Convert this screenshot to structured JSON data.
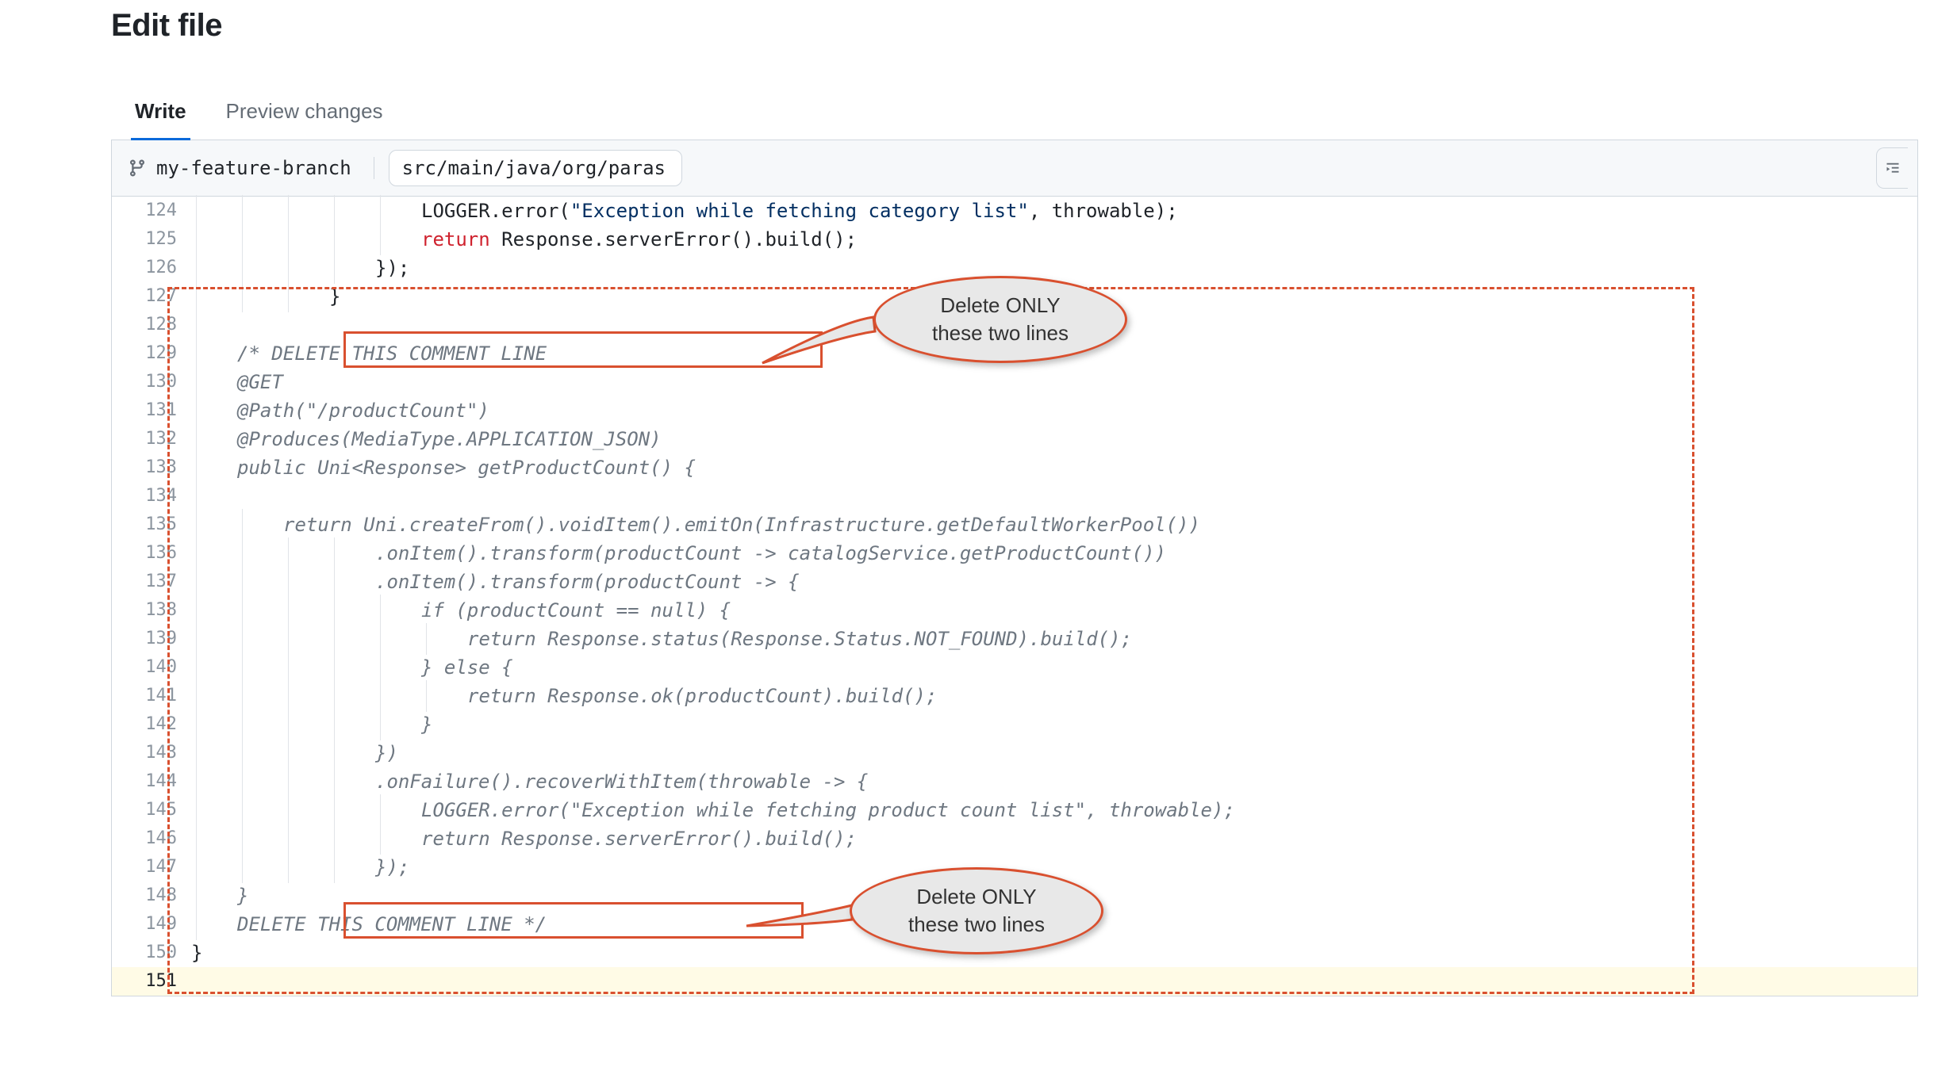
{
  "header": {
    "title": "Edit file"
  },
  "tabs": {
    "write": "Write",
    "preview": "Preview changes"
  },
  "branch": {
    "name": "my-feature-branch",
    "path": "src/main/java/org/paras"
  },
  "lines": [
    {
      "n": 124,
      "indent": 5,
      "segments": [
        {
          "t": "plain",
          "v": "LOGGER.error("
        },
        {
          "t": "strlit",
          "v": "\"Exception while fetching category list\""
        },
        {
          "t": "plain",
          "v": ", throwable);"
        }
      ]
    },
    {
      "n": 125,
      "indent": 5,
      "segments": [
        {
          "t": "kw",
          "v": "return"
        },
        {
          "t": "plain",
          "v": " Response.serverError().build();"
        }
      ]
    },
    {
      "n": 126,
      "indent": 4,
      "segments": [
        {
          "t": "plain",
          "v": "});"
        }
      ]
    },
    {
      "n": 127,
      "indent": 3,
      "segments": [
        {
          "t": "plain",
          "v": "}"
        }
      ]
    },
    {
      "n": 128,
      "indent": 1,
      "segments": []
    },
    {
      "n": 129,
      "indent": 1,
      "segments": [
        {
          "t": "comment",
          "v": "/* DELETE THIS COMMENT LINE"
        }
      ]
    },
    {
      "n": 130,
      "indent": 1,
      "segments": [
        {
          "t": "comment",
          "v": "@GET"
        }
      ]
    },
    {
      "n": 131,
      "indent": 1,
      "segments": [
        {
          "t": "comment",
          "v": "@Path(\"/productCount\")"
        }
      ]
    },
    {
      "n": 132,
      "indent": 1,
      "segments": [
        {
          "t": "comment",
          "v": "@Produces(MediaType.APPLICATION_JSON)"
        }
      ]
    },
    {
      "n": 133,
      "indent": 1,
      "segments": [
        {
          "t": "comment",
          "v": "public Uni<Response> getProductCount() {"
        }
      ]
    },
    {
      "n": 134,
      "indent": 1,
      "segments": []
    },
    {
      "n": 135,
      "indent": 2,
      "segments": [
        {
          "t": "comment",
          "v": "return Uni.createFrom().voidItem().emitOn(Infrastructure.getDefaultWorkerPool())"
        }
      ]
    },
    {
      "n": 136,
      "indent": 4,
      "segments": [
        {
          "t": "comment",
          "v": ".onItem().transform(productCount -> catalogService.getProductCount())"
        }
      ]
    },
    {
      "n": 137,
      "indent": 4,
      "segments": [
        {
          "t": "comment",
          "v": ".onItem().transform(productCount -> {"
        }
      ]
    },
    {
      "n": 138,
      "indent": 5,
      "segments": [
        {
          "t": "comment",
          "v": "if (productCount == null) {"
        }
      ]
    },
    {
      "n": 139,
      "indent": 6,
      "segments": [
        {
          "t": "comment",
          "v": "return Response.status(Response.Status.NOT_FOUND).build();"
        }
      ]
    },
    {
      "n": 140,
      "indent": 5,
      "segments": [
        {
          "t": "comment",
          "v": "} else {"
        }
      ]
    },
    {
      "n": 141,
      "indent": 6,
      "segments": [
        {
          "t": "comment",
          "v": "return Response.ok(productCount).build();"
        }
      ]
    },
    {
      "n": 142,
      "indent": 5,
      "segments": [
        {
          "t": "comment",
          "v": "}"
        }
      ]
    },
    {
      "n": 143,
      "indent": 4,
      "segments": [
        {
          "t": "comment",
          "v": "})"
        }
      ]
    },
    {
      "n": 144,
      "indent": 4,
      "segments": [
        {
          "t": "comment",
          "v": ".onFailure().recoverWithItem(throwable -> {"
        }
      ]
    },
    {
      "n": 145,
      "indent": 5,
      "segments": [
        {
          "t": "comment",
          "v": "LOGGER.error(\"Exception while fetching product count list\", throwable);"
        }
      ]
    },
    {
      "n": 146,
      "indent": 5,
      "segments": [
        {
          "t": "comment",
          "v": "return Response.serverError().build();"
        }
      ]
    },
    {
      "n": 147,
      "indent": 4,
      "segments": [
        {
          "t": "comment",
          "v": "});"
        }
      ]
    },
    {
      "n": 148,
      "indent": 1,
      "segments": [
        {
          "t": "comment",
          "v": "}"
        }
      ]
    },
    {
      "n": 149,
      "indent": 1,
      "segments": [
        {
          "t": "comment",
          "v": "DELETE THIS COMMENT LINE */"
        }
      ]
    },
    {
      "n": 150,
      "indent": 0,
      "segments": [
        {
          "t": "plain",
          "v": "}"
        }
      ]
    },
    {
      "n": 151,
      "indent": 0,
      "segments": [],
      "active": true
    }
  ],
  "callouts": {
    "top": {
      "line1": "Delete ONLY",
      "line2": "these two lines"
    },
    "bottom": {
      "line1": "Delete ONLY",
      "line2": "these two lines"
    }
  },
  "icons": {
    "branch": "git-branch-icon",
    "indent": "indent-icon"
  }
}
